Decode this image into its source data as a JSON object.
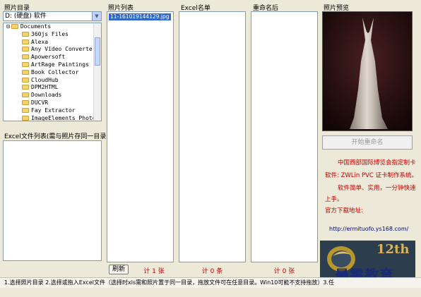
{
  "labels": {
    "photo_dir": "照片目录",
    "excel_list": "Excel文件列表(需与照片存同一目录)",
    "photo_list": "照片列表",
    "excel_names": "Excel名单",
    "renamed": "重命名后",
    "preview": "照片预览"
  },
  "drive": {
    "value": "D:  (硬盘)  软件"
  },
  "tree": {
    "root": "Documents",
    "items": [
      "360js Files",
      "Alexa",
      "Any Video Converter U",
      "Apowersoft",
      "ArtRage Paintings",
      "Book Collector",
      "CloudHub",
      "DPM2HTML",
      "Downloads",
      "DUCVR",
      "Fay Extractor",
      "ImageElements Photo S"
    ]
  },
  "photo_list": {
    "items": [
      "11-161019144129.jpg"
    ]
  },
  "counts": {
    "photos": "计 1 张",
    "excel": "计 0 条",
    "renamed": "计 0 张"
  },
  "buttons": {
    "refresh": "刷新",
    "rename": "开始重命名"
  },
  "info": {
    "line1": "中国西部国际博览会指定制卡",
    "line2": "软件: ZWLin PVC 证卡制作系统。",
    "line3": "软件简单、实用，一分钟快速",
    "line4": "上手。",
    "line5": "官方下载地址:",
    "url": "http://ermituofo.ys168.com/"
  },
  "banner": {
    "text": "12th"
  },
  "status": "1.选择照片目录  2.选择或拖入Excel文件（选择时xls需和照片置于同一目录，拖放文件可在任意目录。Win10可能不支持拖放）3.任",
  "watermark": "最需教育",
  "colors": {
    "count_red": "#c00000",
    "selection_blue": "#316ac5"
  }
}
